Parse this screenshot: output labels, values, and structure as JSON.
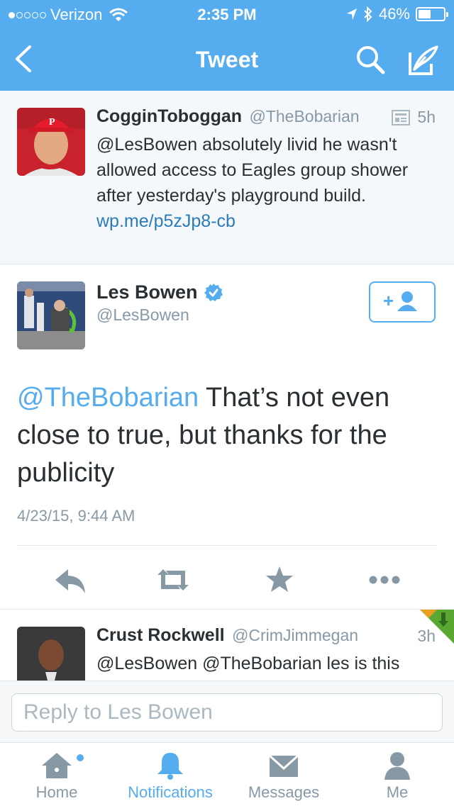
{
  "status_bar": {
    "carrier": "Verizon",
    "time": "2:35 PM",
    "battery": "46%"
  },
  "nav": {
    "title": "Tweet"
  },
  "tweet_parent": {
    "name": "CogginToboggan",
    "handle": "@TheBobarian",
    "age": "5h",
    "text": "@LesBowen absolutely livid he wasn't allowed access to Eagles group shower after yesterday's playground build.",
    "link": "wp.me/p5zJp8-cb"
  },
  "tweet_main": {
    "name": "Les Bowen",
    "handle": "@LesBowen",
    "mention": "@TheBobarian",
    "text": "That’s not even close to true, but thanks for the publicity",
    "timestamp": "4/23/15, 9:44 AM"
  },
  "tweet_reply": {
    "name": "Crust Rockwell",
    "handle": "@CrimJimmegan",
    "age": "3h",
    "text": "@LesBowen @TheBobarian les is this true?! I had some respect for you. but man"
  },
  "reply_bar": {
    "placeholder": "Reply to Les Bowen"
  },
  "tabs": [
    {
      "label": "Home",
      "icon": "home-icon"
    },
    {
      "label": "Notifications",
      "icon": "bell-icon"
    },
    {
      "label": "Messages",
      "icon": "envelope-icon"
    },
    {
      "label": "Me",
      "icon": "person-icon"
    }
  ],
  "colors": {
    "brand": "#55acee",
    "link": "#2b7bb9",
    "muted": "#8899a6",
    "verified": "#55acee"
  }
}
